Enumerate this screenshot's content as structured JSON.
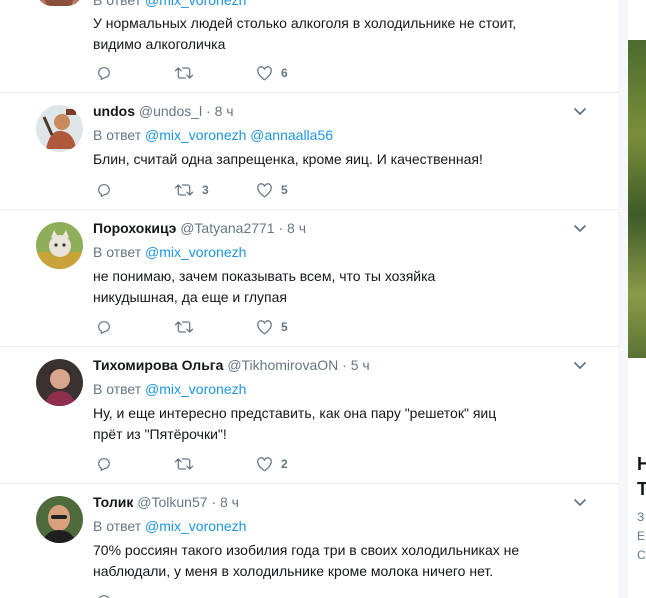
{
  "tweets": [
    {
      "name": "",
      "handle": "@mix_voronezh",
      "time": "",
      "reply_prefix": "В ответ",
      "mentions": [
        "@mix_voronezh"
      ],
      "text": "У нормальных людей столько алкоголя в холодильнике не стоит, видимо алкоголичка",
      "reply_count": "",
      "retweet_count": "",
      "like_count": "6"
    },
    {
      "name": "undos",
      "handle": "@undos_l",
      "time": "8 ч",
      "reply_prefix": "В ответ",
      "mentions": [
        "@mix_voronezh",
        "@annaalla56"
      ],
      "text": "Блин, считай одна запрещенка, кроме яиц. И качественная!",
      "reply_count": "",
      "retweet_count": "3",
      "like_count": "5"
    },
    {
      "name": "Порохокицэ",
      "handle": "@Tatyana2771",
      "time": "8 ч",
      "reply_prefix": "В ответ",
      "mentions": [
        "@mix_voronezh"
      ],
      "text": "не понимаю, зачем показывать всем, что ты хозяйка никудышная, да еще и глупая",
      "reply_count": "",
      "retweet_count": "",
      "like_count": "5"
    },
    {
      "name": "Тихомирова Ольга",
      "handle": "@TikhomirovaON",
      "time": "5 ч",
      "reply_prefix": "В ответ",
      "mentions": [
        "@mix_voronezh"
      ],
      "text": "Ну, и еще интересно представить, как она пару \"решеток\" яиц прёт из \"Пятёрочки\"!",
      "reply_count": "",
      "retweet_count": "",
      "like_count": "2"
    },
    {
      "name": "Толик",
      "handle": "@Tolkun57",
      "time": "8 ч",
      "reply_prefix": "В ответ",
      "mentions": [
        "@mix_voronezh"
      ],
      "text": "70% россиян такого изобилия года три в своих холодильниках не наблюдали, у меня в холодильнике кроме молока ничего нет.",
      "reply_count": "",
      "retweet_count": "",
      "like_count": ""
    }
  ],
  "sidebar": {
    "letters": "Н\nТ",
    "sub": "З\nЕ\nС"
  },
  "colors": {
    "link": "#1b95e0",
    "meta": "#657786",
    "text": "#14171a",
    "border": "#e6ecf0"
  },
  "icons": [
    "reply-icon",
    "retweet-icon",
    "like-icon",
    "chevron-down-icon"
  ]
}
